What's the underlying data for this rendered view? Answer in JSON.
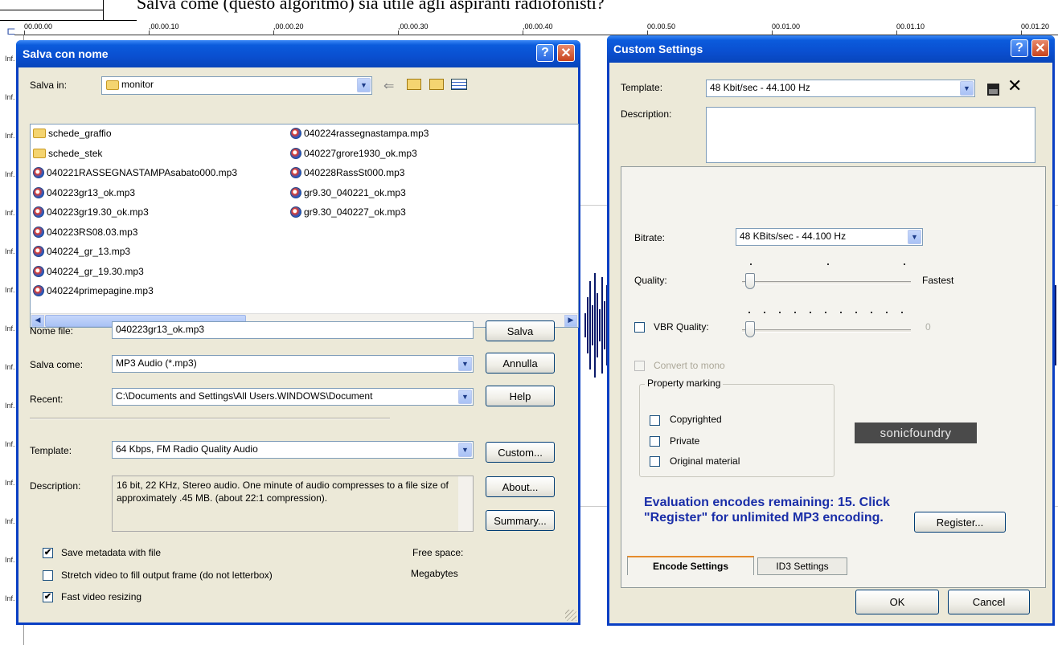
{
  "background": {
    "header_text": "Salva come (questo algoritmo) sia utile agli aspiranti radiofonisti?",
    "ruler_ticks": [
      "00.00.00",
      ",00.00.10",
      ",00.00.20",
      ",00.00.30",
      ",00.00.40",
      "00.00.50",
      "00.01.00",
      "00.01.10",
      "00.01.20"
    ],
    "axis_labels": [
      "Inf.",
      "Inf.",
      "Inf.",
      "Inf.",
      "Inf.",
      "Inf.",
      "Inf.",
      "Inf.",
      "Inf.",
      "Inf.",
      "Inf.",
      "Inf.",
      "Inf.",
      "Inf.",
      "Inf."
    ]
  },
  "save_dialog": {
    "title": "Salva con nome",
    "save_in_label": "Salva in:",
    "save_in_value": "monitor",
    "files_col1": [
      {
        "name": "schede_graffio",
        "type": "folder"
      },
      {
        "name": "schede_stek",
        "type": "folder"
      },
      {
        "name": "040221RASSEGNASTAMPAsabato000.mp3",
        "type": "mp3"
      },
      {
        "name": "040223gr13_ok.mp3",
        "type": "mp3"
      },
      {
        "name": "040223gr19.30_ok.mp3",
        "type": "mp3"
      },
      {
        "name": "040223RS08.03.mp3",
        "type": "mp3"
      },
      {
        "name": "040224_gr_13.mp3",
        "type": "mp3"
      },
      {
        "name": "040224_gr_19.30.mp3",
        "type": "mp3"
      },
      {
        "name": "040224primepagine.mp3",
        "type": "mp3"
      }
    ],
    "files_col2": [
      {
        "name": "040224rassegnastampa.mp3",
        "type": "mp3"
      },
      {
        "name": "040227grore1930_ok.mp3",
        "type": "mp3"
      },
      {
        "name": "040228RassSt000.mp3",
        "type": "mp3"
      },
      {
        "name": "gr9.30_040221_ok.mp3",
        "type": "mp3"
      },
      {
        "name": "gr9.30_040227_ok.mp3",
        "type": "mp3"
      }
    ],
    "filename_label": "Nome file:",
    "filename_value": "040223gr13_ok.mp3",
    "saveas_label": "Salva come:",
    "saveas_value": "MP3 Audio (*.mp3)",
    "recent_label": "Recent:",
    "recent_value": "C:\\Documents and Settings\\All Users.WINDOWS\\Document",
    "template_label": "Template:",
    "template_value": "64 Kbps, FM Radio Quality Audio",
    "description_label": "Description:",
    "description_value": "16 bit, 22 KHz, Stereo audio. One minute of audio compresses to a file size of approximately .45 MB. (about 22:1 compression).",
    "btn_save": "Salva",
    "btn_cancel": "Annulla",
    "btn_help": "Help",
    "btn_custom": "Custom...",
    "btn_about": "About...",
    "btn_summary": "Summary...",
    "chk_metadata": "Save metadata with file",
    "chk_metadata_checked": true,
    "chk_stretch": "Stretch video to fill output frame (do not letterbox)",
    "chk_stretch_checked": false,
    "chk_fast": "Fast video resizing",
    "chk_fast_checked": true,
    "free_space_label": "Free space:",
    "megabytes_label": "Megabytes"
  },
  "custom_dialog": {
    "title": "Custom Settings",
    "template_label": "Template:",
    "template_value": "48 Kbit/sec - 44.100 Hz",
    "description_label": "Description:",
    "description_value": "",
    "bitrate_label": "Bitrate:",
    "bitrate_value": "48 KBits/sec - 44.100 Hz",
    "quality_label": "Quality:",
    "quality_max_label": "Fastest",
    "quality_level": 0,
    "vbr_label": "VBR Quality:",
    "vbr_value": "0",
    "vbr_checked": false,
    "convert_mono_label": "Convert to mono",
    "property_marking_label": "Property marking",
    "copyrighted_label": "Copyrighted",
    "private_label": "Private",
    "original_label": "Original material",
    "sonic_logo": "sonicfoundry",
    "eval_text": "Evaluation encodes remaining: 15. Click \"Register\" for unlimited MP3 encoding.",
    "btn_register": "Register...",
    "tab_encode": "Encode Settings",
    "tab_id3": "ID3 Settings",
    "btn_ok": "OK",
    "btn_cancel": "Cancel"
  }
}
